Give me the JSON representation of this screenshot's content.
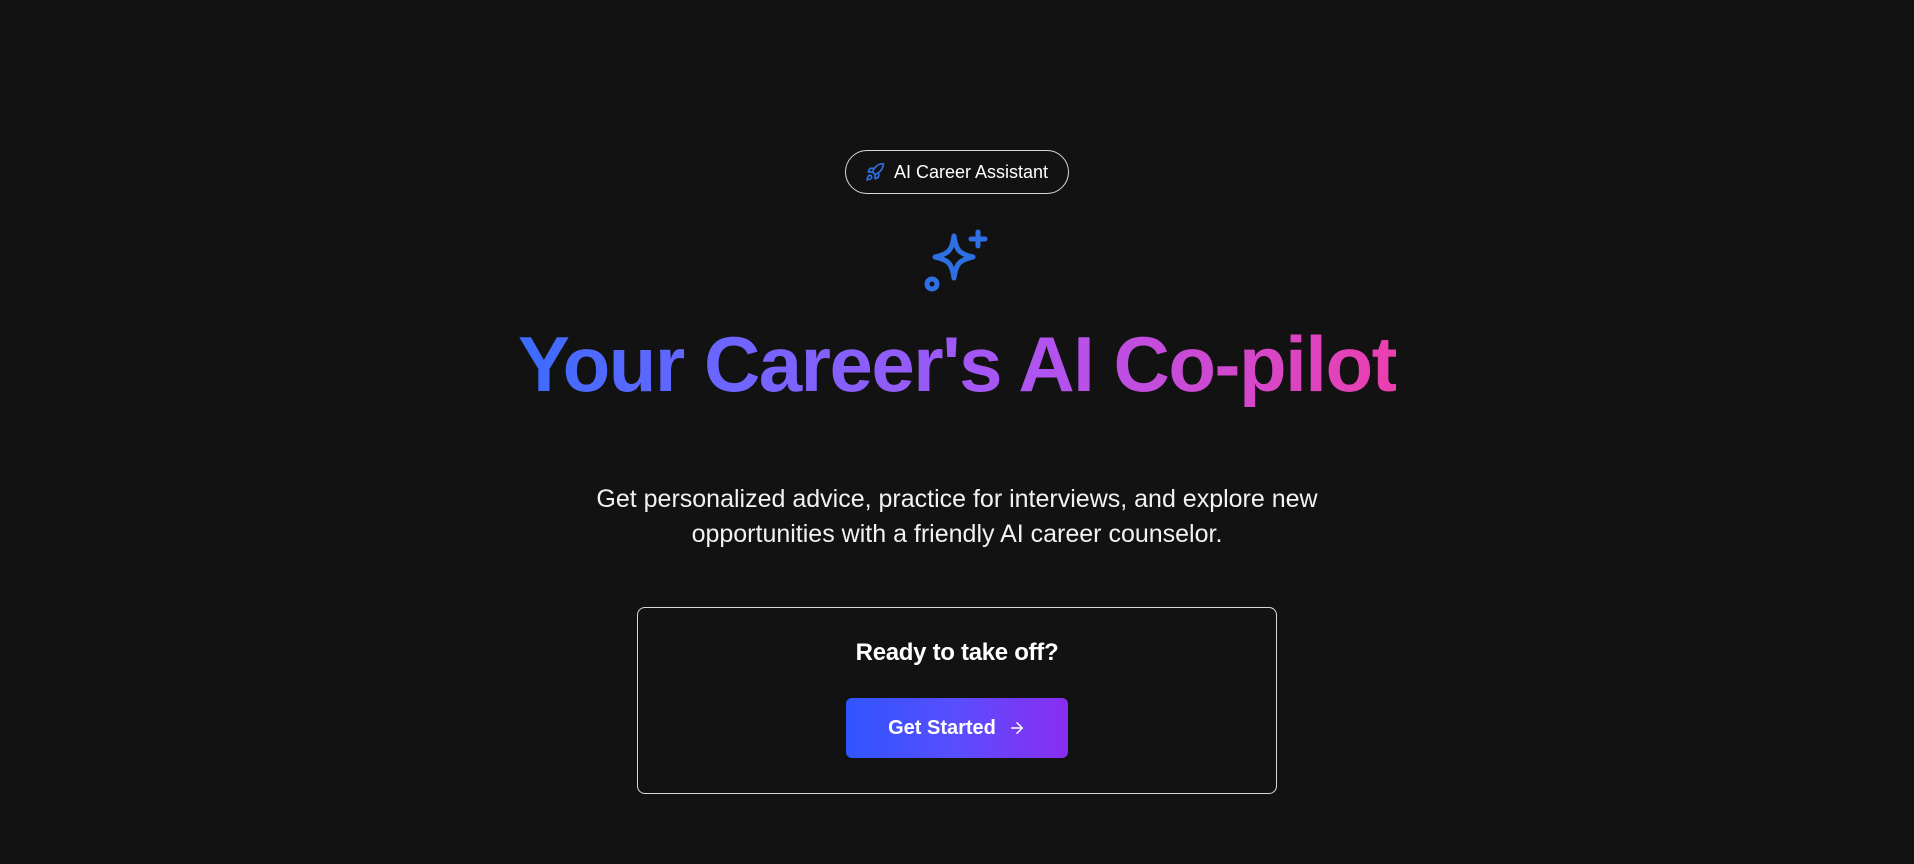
{
  "badge": {
    "icon": "rocket-icon",
    "label": "AI Career Assistant"
  },
  "hero": {
    "icon": "sparkles-icon",
    "headline": "Your Career's AI Co-pilot",
    "subtitle": "Get personalized advice, practice for interviews, and explore new opportunities with a friendly AI career counselor."
  },
  "cta": {
    "title": "Ready to take off?",
    "button_label": "Get Started",
    "button_icon": "arrow-right-icon"
  },
  "colors": {
    "background": "#121212",
    "accent_blue": "#2f6fe4",
    "gradient_start": "#3b6cff",
    "gradient_mid": "#b153f0",
    "gradient_end": "#ec3fae",
    "button_start": "#2f55ff",
    "button_end": "#8a2df0"
  }
}
